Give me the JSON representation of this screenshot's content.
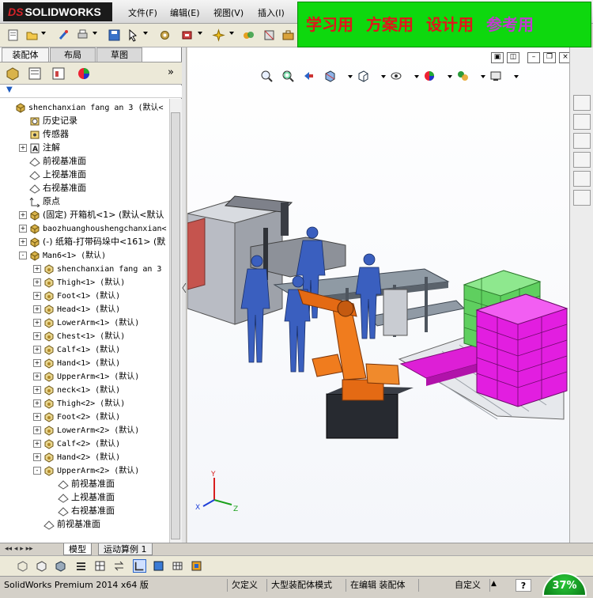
{
  "app": {
    "logo_prefix": "DS",
    "logo_text": "SOLIDWORKS",
    "menus": [
      "文件(F)",
      "编辑(E)",
      "视图(V)",
      "插入(I)"
    ]
  },
  "banner": {
    "parts": [
      "学习用",
      "方案用",
      "设计用",
      "参考用"
    ],
    "bg": "#0ed80e",
    "text_color": "#e0151a",
    "alt_color": "#c23ad0"
  },
  "panel": {
    "tabs": [
      "装配体",
      "布局",
      "草图"
    ],
    "collapse_glyph": "»",
    "filter_glyph": "▼"
  },
  "tree": [
    {
      "depth": 0,
      "exp": "",
      "icon": "assembly",
      "label": "shenchanxian fang an 3  (默认<",
      "mono": true
    },
    {
      "depth": 1,
      "exp": "",
      "icon": "history",
      "label": "历史记录",
      "mono": false
    },
    {
      "depth": 1,
      "exp": "",
      "icon": "sensor",
      "label": "传感器",
      "mono": false
    },
    {
      "depth": 1,
      "exp": "+",
      "icon": "annotation",
      "label": "注解",
      "mono": false
    },
    {
      "depth": 1,
      "exp": "",
      "icon": "plane",
      "label": "前视基准面",
      "mono": false
    },
    {
      "depth": 1,
      "exp": "",
      "icon": "plane",
      "label": "上视基准面",
      "mono": false
    },
    {
      "depth": 1,
      "exp": "",
      "icon": "plane",
      "label": "右视基准面",
      "mono": false
    },
    {
      "depth": 1,
      "exp": "",
      "icon": "origin",
      "label": "原点",
      "mono": false
    },
    {
      "depth": 1,
      "exp": "+",
      "icon": "assembly",
      "label": "(固定) 开箱机<1> (默认<默认",
      "mono": false
    },
    {
      "depth": 1,
      "exp": "+",
      "icon": "assembly",
      "label": "baozhuanghoushengchanxian<",
      "mono": true
    },
    {
      "depth": 1,
      "exp": "+",
      "icon": "assembly",
      "label": "(-) 纸箱-打带码垛中<161> (默",
      "mono": false
    },
    {
      "depth": 1,
      "exp": "-",
      "icon": "assembly",
      "label": "Man6<1> (默认)",
      "mono": true
    },
    {
      "depth": 2,
      "exp": "+",
      "icon": "part",
      "label": "shenchanxian fang an 3",
      "mono": true
    },
    {
      "depth": 2,
      "exp": "+",
      "icon": "part",
      "label": "Thigh<1> (默认)",
      "mono": true
    },
    {
      "depth": 2,
      "exp": "+",
      "icon": "part",
      "label": "Foot<1> (默认)",
      "mono": true
    },
    {
      "depth": 2,
      "exp": "+",
      "icon": "part",
      "label": "Head<1> (默认)",
      "mono": true
    },
    {
      "depth": 2,
      "exp": "+",
      "icon": "part",
      "label": "LowerArm<1> (默认)",
      "mono": true
    },
    {
      "depth": 2,
      "exp": "+",
      "icon": "part",
      "label": "Chest<1> (默认)",
      "mono": true
    },
    {
      "depth": 2,
      "exp": "+",
      "icon": "part",
      "label": "Calf<1> (默认)",
      "mono": true
    },
    {
      "depth": 2,
      "exp": "+",
      "icon": "part",
      "label": "Hand<1> (默认)",
      "mono": true
    },
    {
      "depth": 2,
      "exp": "+",
      "icon": "part",
      "label": "UpperArm<1> (默认)",
      "mono": true
    },
    {
      "depth": 2,
      "exp": "+",
      "icon": "part",
      "label": "neck<1> (默认)",
      "mono": true
    },
    {
      "depth": 2,
      "exp": "+",
      "icon": "part",
      "label": "Thigh<2> (默认)",
      "mono": true
    },
    {
      "depth": 2,
      "exp": "+",
      "icon": "part",
      "label": "Foot<2> (默认)",
      "mono": true
    },
    {
      "depth": 2,
      "exp": "+",
      "icon": "part",
      "label": "LowerArm<2> (默认)",
      "mono": true
    },
    {
      "depth": 2,
      "exp": "+",
      "icon": "part",
      "label": "Calf<2> (默认)",
      "mono": true
    },
    {
      "depth": 2,
      "exp": "+",
      "icon": "part",
      "label": "Hand<2> (默认)",
      "mono": true
    },
    {
      "depth": 2,
      "exp": "-",
      "icon": "part",
      "label": "UpperArm<2> (默认)",
      "mono": true
    },
    {
      "depth": 3,
      "exp": "",
      "icon": "plane",
      "label": "前视基准面",
      "mono": false
    },
    {
      "depth": 3,
      "exp": "",
      "icon": "plane",
      "label": "上视基准面",
      "mono": false
    },
    {
      "depth": 3,
      "exp": "",
      "icon": "plane",
      "label": "右视基准面",
      "mono": false
    },
    {
      "depth": 2,
      "exp": "",
      "icon": "plane",
      "label": "前视基准面",
      "mono": false
    }
  ],
  "axes": {
    "x": "X",
    "y": "Y",
    "z": "Z"
  },
  "bottom_tabs": [
    "模型",
    "运动算例 1"
  ],
  "status": {
    "app_version": "SolidWorks Premium 2014 x64 版",
    "undefined": "欠定义",
    "mode": "大型装配体模式",
    "editing": "在编辑 装配体",
    "custom": "自定义",
    "help": "?",
    "zoom": "37%"
  }
}
